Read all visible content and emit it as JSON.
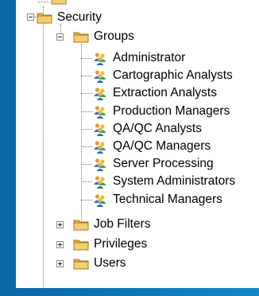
{
  "tree": {
    "security": {
      "label": "Security",
      "icon": "security-folder-icon",
      "groups": {
        "label": "Groups",
        "icon": "groups-folder-icon",
        "items": [
          {
            "label": "Administrator",
            "icon": "users-group-icon"
          },
          {
            "label": "Cartographic Analysts",
            "icon": "users-group-icon"
          },
          {
            "label": "Extraction Analysts",
            "icon": "users-group-icon"
          },
          {
            "label": "Production Managers",
            "icon": "users-group-icon"
          },
          {
            "label": "QA/QC Analysts",
            "icon": "users-group-icon"
          },
          {
            "label": "QA/QC Managers",
            "icon": "users-group-icon"
          },
          {
            "label": "Server Processing",
            "icon": "users-group-icon"
          },
          {
            "label": "System Administrators",
            "icon": "users-group-icon"
          },
          {
            "label": "Technical Managers",
            "icon": "users-group-icon"
          }
        ]
      },
      "siblings": [
        {
          "label": "Job Filters",
          "icon": "job-filters-folder-icon"
        },
        {
          "label": "Privileges",
          "icon": "privileges-folder-icon"
        },
        {
          "label": "Users",
          "icon": "users-folder-icon"
        }
      ]
    }
  },
  "colors": {
    "background": "#0c6fae",
    "tree_background": "#ffffff",
    "folder": "#e8b84a",
    "person_blue": "#3a7bd5",
    "person_green": "#3aa845",
    "person_orange": "#e89a2a"
  }
}
